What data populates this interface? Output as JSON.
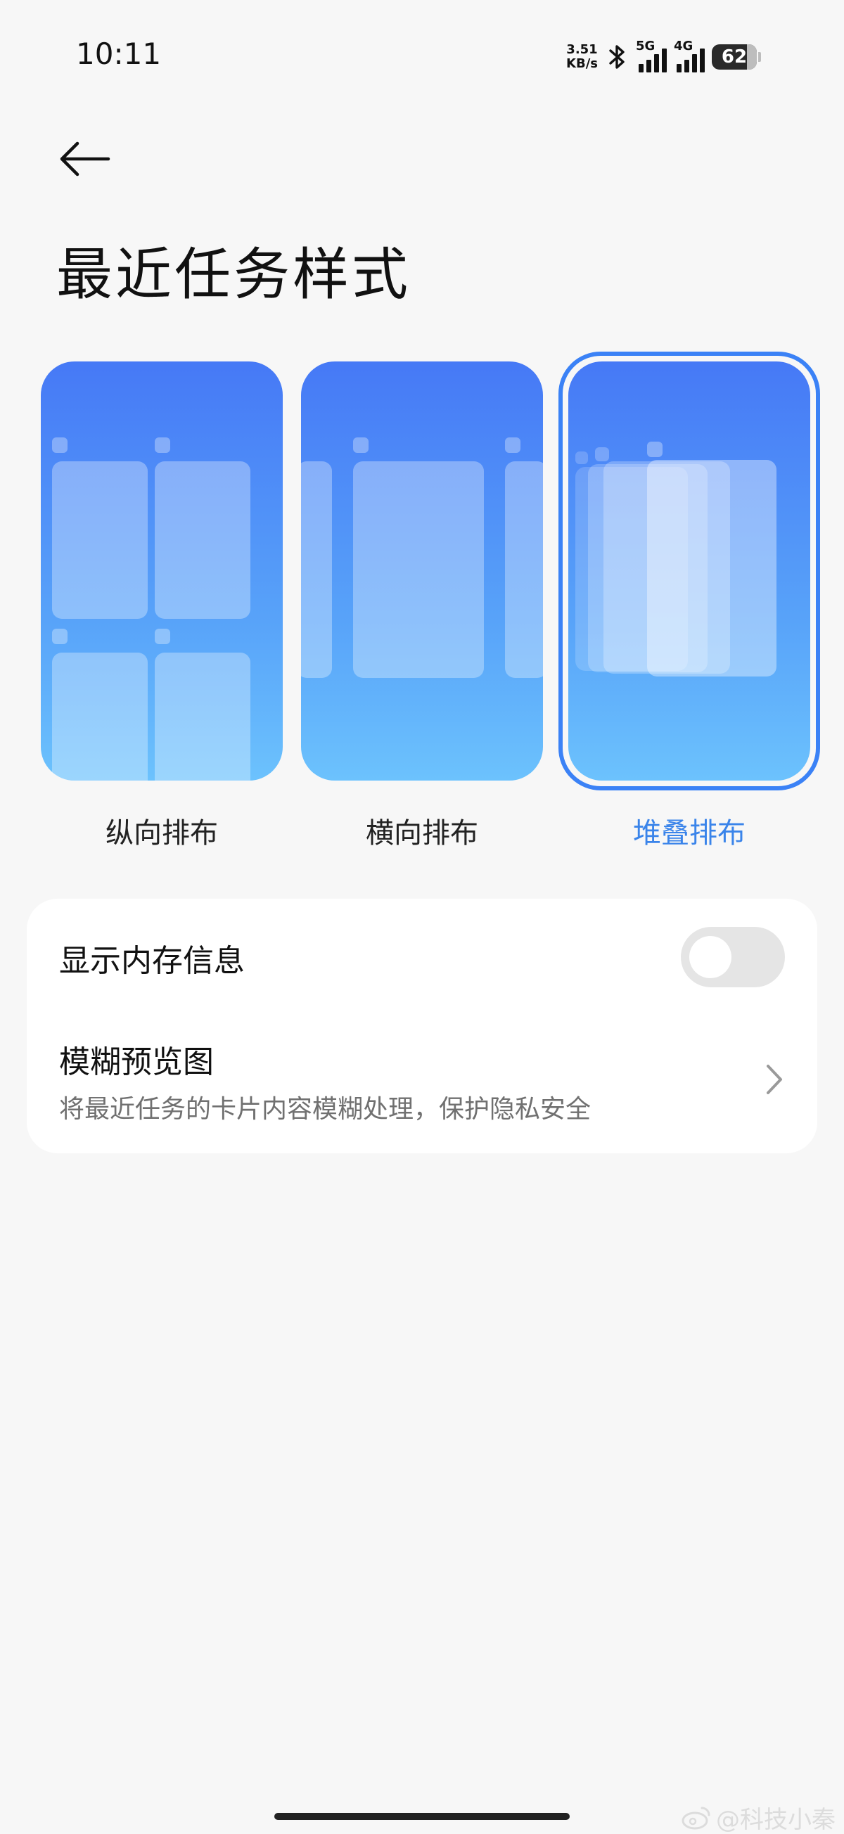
{
  "status_bar": {
    "time": "10:11",
    "net_speed_value": "3.51",
    "net_speed_unit": "KB/s",
    "sim1_label": "5G",
    "sim2_label": "4G",
    "battery": "62",
    "icons": [
      "bluetooth-icon",
      "signal-icon",
      "signal-icon",
      "battery-icon"
    ]
  },
  "header": {
    "back_icon": "arrow-left-icon",
    "title": "最近任务样式"
  },
  "styles": {
    "selected_index": 2,
    "accent_color": "#3a84ea",
    "options": [
      {
        "label": "纵向排布"
      },
      {
        "label": "横向排布"
      },
      {
        "label": "堆叠排布"
      }
    ]
  },
  "settings": {
    "memory_info": {
      "label": "显示内存信息",
      "enabled": false
    },
    "blur_preview": {
      "label": "模糊预览图",
      "description": "将最近任务的卡片内容模糊处理，保护隐私安全",
      "icon": "chevron-right-icon"
    }
  },
  "watermark": "@科技小秦"
}
